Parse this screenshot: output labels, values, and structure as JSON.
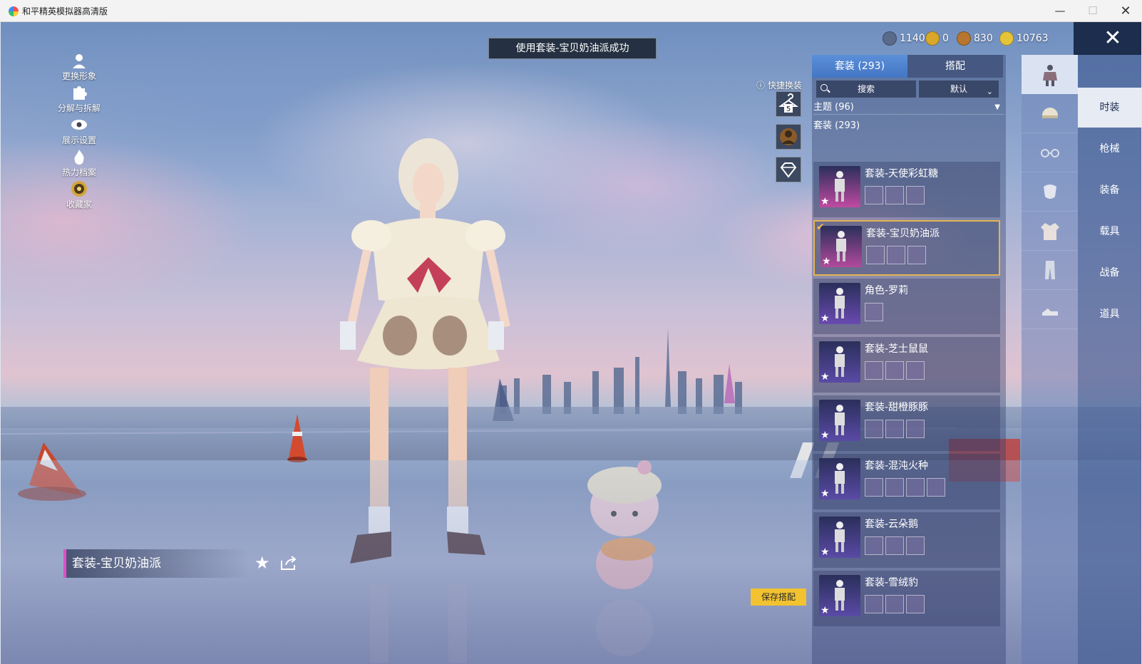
{
  "window": {
    "title": "和平精英模拟器高清版",
    "minimize": "—",
    "maximize": "☐",
    "close": "✕"
  },
  "toast": "使用套装-宝贝奶油派成功",
  "left_menu": [
    {
      "label": "更换形象",
      "icon": "person-icon"
    },
    {
      "label": "分解与拆解",
      "icon": "puzzle-icon"
    },
    {
      "label": "展示设置",
      "icon": "eye-icon"
    },
    {
      "label": "热力档案",
      "icon": "flame-icon"
    },
    {
      "label": "收藏家",
      "icon": "collector-badge-icon"
    }
  ],
  "currencies": [
    {
      "name": "globe-coin",
      "value": "1140",
      "color": "#5a6a8a"
    },
    {
      "name": "gold-coin",
      "value": "0",
      "color": "#d9a72a"
    },
    {
      "name": "bronze-coin",
      "value": "830",
      "color": "#b7752f"
    },
    {
      "name": "yellow-coin",
      "value": "10763",
      "color": "#e6c43a"
    }
  ],
  "quick_change": {
    "label": "快捷换装",
    "slot_number": "5"
  },
  "panel": {
    "tab_set": "套装 (293)",
    "tab_mix": "搭配",
    "search": "搜索",
    "sort": "默认",
    "theme": "主题 (96)",
    "set_count": "套装 (293)"
  },
  "cards": [
    {
      "name": "套装-天使彩虹糖",
      "items": 3,
      "selected": false,
      "accent": "#c04aa2"
    },
    {
      "name": "套装-宝贝奶油派",
      "items": 3,
      "selected": true,
      "accent": "#b24a9c"
    },
    {
      "name": "角色-罗莉",
      "items": 1,
      "selected": false,
      "accent": "#6a4ab2"
    },
    {
      "name": "套装-芝士鼠鼠",
      "items": 3,
      "selected": false,
      "accent": "#5a4aa6"
    },
    {
      "name": "套装-甜橙豚豚",
      "items": 3,
      "selected": false,
      "accent": "#5a4aa6"
    },
    {
      "name": "套装-混沌火种",
      "items": 4,
      "selected": false,
      "accent": "#5a4aa6"
    },
    {
      "name": "套装-云朵鹅",
      "items": 3,
      "selected": false,
      "accent": "#5a4aa6"
    },
    {
      "name": "套装-雪绒豹",
      "items": 3,
      "selected": false,
      "accent": "#5a4aa6"
    }
  ],
  "category_tabs": [
    "时装",
    "枪械",
    "装备",
    "载具",
    "战备",
    "道具"
  ],
  "rail_icons": [
    "outfit-icon",
    "helmet-icon",
    "glasses-icon",
    "mask-icon",
    "shirt-icon",
    "pants-icon",
    "shoes-icon"
  ],
  "outfit_name": "套装-宝贝奶油派",
  "save_button": "保存搭配"
}
